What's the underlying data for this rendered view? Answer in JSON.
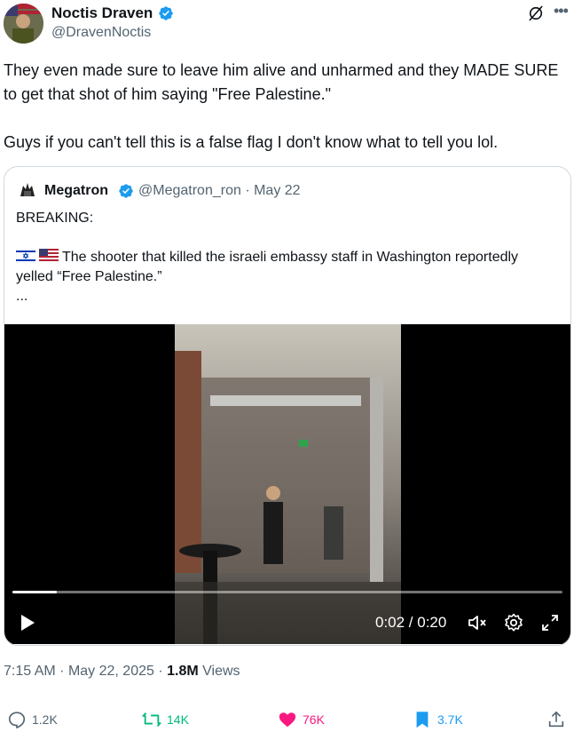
{
  "author": {
    "name": "Noctis Draven",
    "handle": "@DravenNoctis"
  },
  "tweet": {
    "line1": "They even made sure to leave him alive and unharmed and they MADE SURE to get that shot of him saying \"Free Palestine.\"",
    "line2": "Guys if you can't tell this is a false flag I don't know what to tell you lol."
  },
  "quote": {
    "name": "Megatron",
    "handle": "@Megatron_ron",
    "date": "May 22",
    "heading": "BREAKING:",
    "body": "The shooter that killed the israeli embassy staff in Washington reportedly yelled “Free Palestine.”",
    "ellipsis": "...",
    "flags": [
      "israel-flag-icon",
      "us-flag-icon"
    ]
  },
  "video": {
    "time": "0:02 / 0:20",
    "progress": 0.08
  },
  "meta": {
    "time": "7:15 AM",
    "date": "May 22, 2025",
    "views": "1.8M",
    "views_label": "Views",
    "sep": "·"
  },
  "actions": {
    "replies": "1.2K",
    "reposts": "14K",
    "likes": "76K",
    "bookmarks": "3.7K"
  },
  "colors": {
    "verified": "#1d9bf0",
    "repost": "#00ba7c",
    "like": "#f91880",
    "bookmark": "#1d9bf0",
    "muted": "#536471"
  }
}
